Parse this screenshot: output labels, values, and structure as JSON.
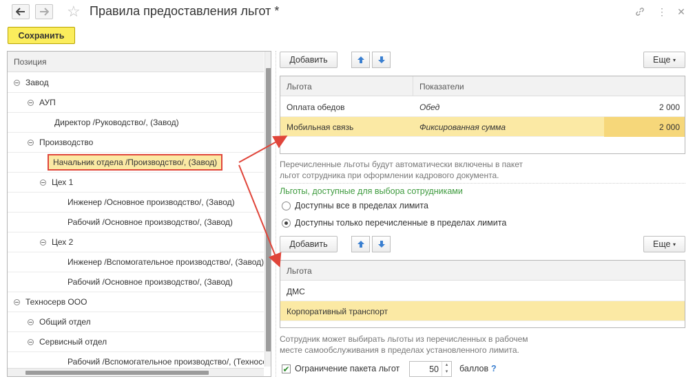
{
  "window": {
    "title": "Правила предоставления льгот *"
  },
  "toolbar": {
    "save_label": "Сохранить"
  },
  "tree": {
    "header": "Позиция",
    "rows": [
      {
        "label": "Завод",
        "level": 0,
        "toggle": true
      },
      {
        "label": "АУП",
        "level": 1,
        "toggle": true
      },
      {
        "label": "Директор /Руководство/, (Завод)",
        "level": 2,
        "toggle": false
      },
      {
        "label": "Производство",
        "level": 1,
        "toggle": true
      },
      {
        "label": "Начальник отдела /Производство/, (Завод)",
        "level": 2,
        "toggle": false,
        "selected": true
      },
      {
        "label": "Цех 1",
        "level": 2,
        "toggle": true
      },
      {
        "label": "Инженер /Основное производство/, (Завод)",
        "level": 3,
        "toggle": false
      },
      {
        "label": "Рабочий /Основное производство/, (Завод)",
        "level": 3,
        "toggle": false
      },
      {
        "label": "Цех 2",
        "level": 2,
        "toggle": true
      },
      {
        "label": "Инженер /Вспомогательное производство/, (Завод)",
        "level": 3,
        "toggle": false
      },
      {
        "label": "Рабочий /Основное производство/, (Завод)",
        "level": 3,
        "toggle": false
      },
      {
        "label": "Техносерв ООО",
        "level": 0,
        "toggle": true
      },
      {
        "label": "Общий отдел",
        "level": 1,
        "toggle": true
      },
      {
        "label": "Сервисный отдел",
        "level": 1,
        "toggle": true
      },
      {
        "label": "Рабочий /Вспомогательное производство/, (Техносерв ООО)",
        "level": 3,
        "toggle": false
      }
    ]
  },
  "top_panel": {
    "add_label": "Добавить",
    "more_label": "Еще",
    "columns": [
      "Льгота",
      "Показатели"
    ],
    "rows": [
      {
        "benefit": "Оплата обедов",
        "indicator": "Обед",
        "value": "2 000"
      },
      {
        "benefit": "Мобильная связь",
        "indicator": "Фиксированная сумма",
        "value": "2 000"
      }
    ],
    "hint_line1": "Перечисленные льготы будут автоматически включены в пакет",
    "hint_line2": "льгот сотрудника при оформлении кадрового документа."
  },
  "choice_section": {
    "title": "Льготы, доступные для выбора сотрудниками",
    "option_all": "Доступны все в пределах лимита",
    "option_listed": "Доступны только перечисленные в пределах лимита",
    "selected": "option_listed"
  },
  "bottom_panel": {
    "add_label": "Добавить",
    "more_label": "Еще",
    "column": "Льгота",
    "rows": [
      "ДМС",
      "Корпоративный транспорт"
    ],
    "hint_line1": "Сотрудник может выбирать льготы из перечисленных в рабочем",
    "hint_line2": "месте самообслуживания в пределах установленного лимита."
  },
  "limit": {
    "checkbox_label": "Ограничение пакета льгот",
    "checked": true,
    "value": "50",
    "unit": "баллов",
    "help": "?"
  },
  "colors": {
    "accent_yellow": "#fbed5c",
    "selection": "#fbe9a4",
    "highlight_red": "#e0453a",
    "green_text": "#3d9a3d"
  }
}
